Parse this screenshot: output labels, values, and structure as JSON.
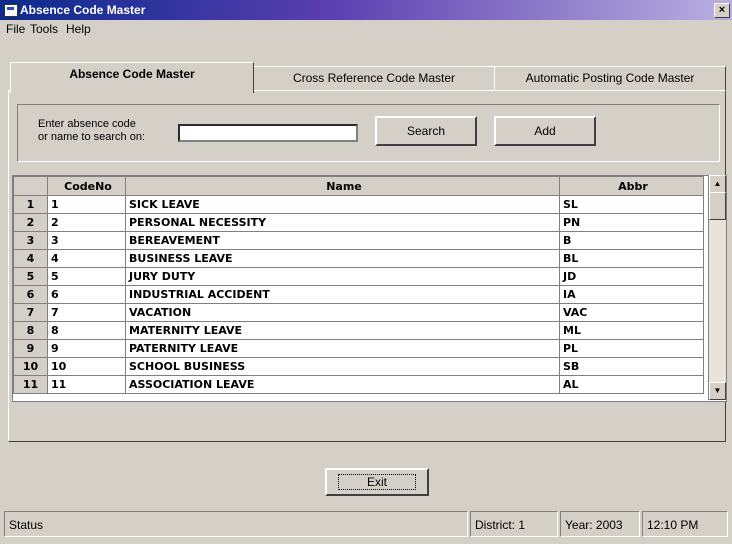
{
  "window": {
    "title": "Absence Code Master",
    "close_glyph": "×"
  },
  "menu": [
    "File",
    "Tools",
    "Help"
  ],
  "tabs": [
    {
      "label": "Absence Code Master",
      "active": true
    },
    {
      "label": "Cross Reference Code Master",
      "active": false
    },
    {
      "label": "Automatic Posting Code Master",
      "active": false
    }
  ],
  "search": {
    "label_line1": "Enter absence code",
    "label_line2": "or name to search on:",
    "value": "",
    "search_button": "Search",
    "add_button": "Add"
  },
  "grid": {
    "columns": [
      "CodeNo",
      "Name",
      "Abbr"
    ],
    "rows": [
      {
        "num": "1",
        "code": "1",
        "name": "SICK LEAVE",
        "abbr": "SL"
      },
      {
        "num": "2",
        "code": "2",
        "name": "PERSONAL NECESSITY",
        "abbr": "PN"
      },
      {
        "num": "3",
        "code": "3",
        "name": "BEREAVEMENT",
        "abbr": "B"
      },
      {
        "num": "4",
        "code": "4",
        "name": "BUSINESS LEAVE",
        "abbr": "BL"
      },
      {
        "num": "5",
        "code": "5",
        "name": "JURY DUTY",
        "abbr": "JD"
      },
      {
        "num": "6",
        "code": "6",
        "name": "INDUSTRIAL ACCIDENT",
        "abbr": "IA"
      },
      {
        "num": "7",
        "code": "7",
        "name": "VACATION",
        "abbr": "VAC"
      },
      {
        "num": "8",
        "code": "8",
        "name": "MATERNITY LEAVE",
        "abbr": "ML"
      },
      {
        "num": "9",
        "code": "9",
        "name": "PATERNITY LEAVE",
        "abbr": "PL"
      },
      {
        "num": "10",
        "code": "10",
        "name": "SCHOOL BUSINESS",
        "abbr": "SB"
      },
      {
        "num": "11",
        "code": "11",
        "name": "ASSOCIATION LEAVE",
        "abbr": "AL"
      }
    ]
  },
  "exit_button": "Exit",
  "status": {
    "text": "Status",
    "district": "District: 1",
    "year": "Year: 2003",
    "time": "12:10 PM"
  }
}
